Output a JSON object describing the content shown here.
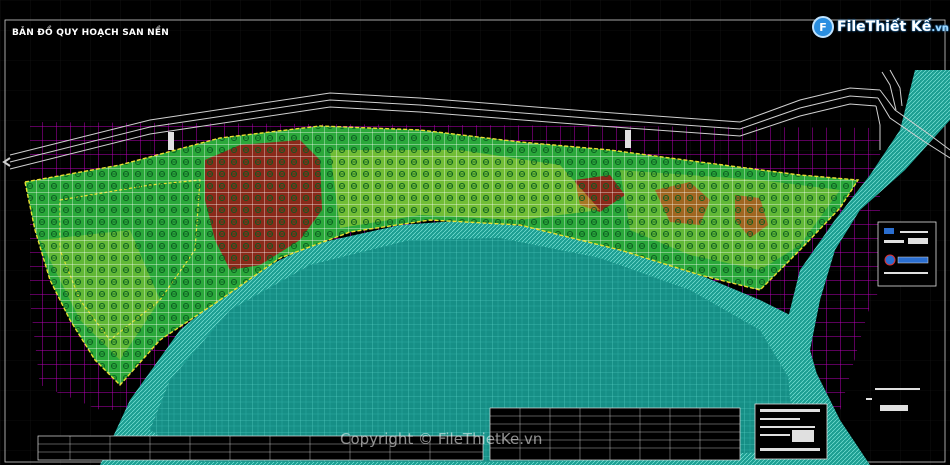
{
  "map": {
    "title": "BẢN ĐỒ QUY HOẠCH SAN NỀN",
    "logo_badge": "F",
    "logo_main": "FileThiết Kế",
    "logo_tld": ".vn",
    "watermark": "Copyright © FileThietKe.vn"
  },
  "colors": {
    "background": "#000000",
    "magenta_grid": "#c000c0",
    "water": "#1aa89a",
    "land": "#2aa83a",
    "high_ground": "#8a2a1a",
    "contours": "#e8e030",
    "road": "#d0d0d0",
    "white_grid": "#ffffff"
  },
  "icons": [
    "legend-box",
    "north-arrow",
    "title-block",
    "data-table"
  ]
}
